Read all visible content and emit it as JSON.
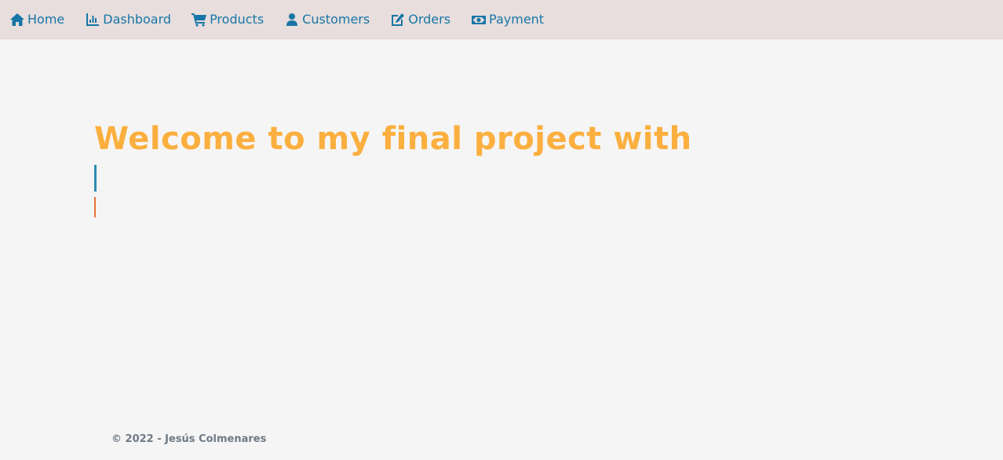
{
  "nav": {
    "items": [
      {
        "label": "Home",
        "icon": "home-icon"
      },
      {
        "label": "Dashboard",
        "icon": "chart-icon"
      },
      {
        "label": "Products",
        "icon": "cart-icon"
      },
      {
        "label": "Customers",
        "icon": "user-icon"
      },
      {
        "label": "Orders",
        "icon": "edit-icon"
      },
      {
        "label": "Payment",
        "icon": "money-icon"
      }
    ]
  },
  "hero": {
    "title": "Welcome to my final project with"
  },
  "footer": {
    "text": "© 2022 - Jesús Colmenares"
  },
  "colors": {
    "nav_background": "#e8dedd",
    "nav_link": "#1776a6",
    "page_background": "#f5f5f5",
    "title": "#fbaf3f",
    "cursor_primary": "#2f8db3",
    "cursor_secondary": "#e8733a",
    "footer_text": "#6f7a86"
  }
}
